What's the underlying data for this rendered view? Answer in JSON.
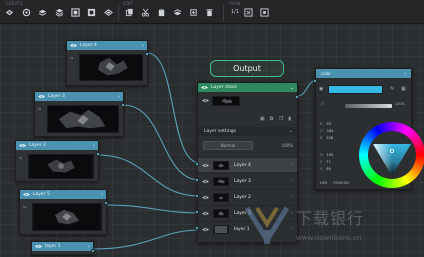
{
  "colors": {
    "canvas": "#2b2e30",
    "layer_node_header": "#4a92b0",
    "stack_header": "#2e8a5e",
    "output_outline": "#3fbf86",
    "wire": "#5faec9",
    "selected_color": "#35b8e4"
  },
  "toolbar": {
    "groups": [
      {
        "label": "create"
      },
      {
        "label": "edit"
      },
      {
        "label": "view"
      }
    ],
    "create_icons": [
      "add-layer-icon",
      "add-adjustment-icon",
      "add-group-icon",
      "add-fill-icon",
      "add-mask-icon",
      "add-filter-icon",
      "add-output-icon"
    ],
    "edit_icons": [
      "copy-icon",
      "cut-icon",
      "paste-icon",
      "duplicate-icon",
      "delete-icon"
    ],
    "view_zoom": "1/1",
    "view_icons": [
      "fit-view-icon",
      "zoom-selection-icon"
    ]
  },
  "output_label": "Output",
  "layer_nodes": [
    {
      "title": "Layer 4"
    },
    {
      "title": "Layer 3"
    },
    {
      "title": "Layer 2"
    },
    {
      "title": "Layer 5"
    },
    {
      "title": "layer 1"
    }
  ],
  "stack": {
    "title": "Layer stack",
    "settings_title": "Layer settings",
    "blend_mode": "Normal",
    "opacity": "100%",
    "rows": [
      {
        "name": "Layer 4",
        "selected": true
      },
      {
        "name": "Layer 3",
        "selected": false
      },
      {
        "name": "Layer 2",
        "selected": false
      },
      {
        "name": "Layer 5",
        "selected": false
      },
      {
        "name": "layer 1",
        "selected": false
      }
    ]
  },
  "color_node": {
    "title": "color",
    "swatch": "#35b8e4",
    "alpha": "100%",
    "rgb": [
      {
        "k": "R",
        "v": "53"
      },
      {
        "k": "G",
        "v": "184"
      },
      {
        "k": "B",
        "v": "228"
      }
    ],
    "hsv": [
      {
        "k": "H",
        "v": "195"
      },
      {
        "k": "S",
        "v": "77"
      },
      {
        "k": "V",
        "v": "89"
      }
    ],
    "tabs": [
      "HEX",
      "RGB/HSV"
    ]
  },
  "watermark": {
    "text": "下载银行",
    "url": "www.downbank.cn"
  }
}
